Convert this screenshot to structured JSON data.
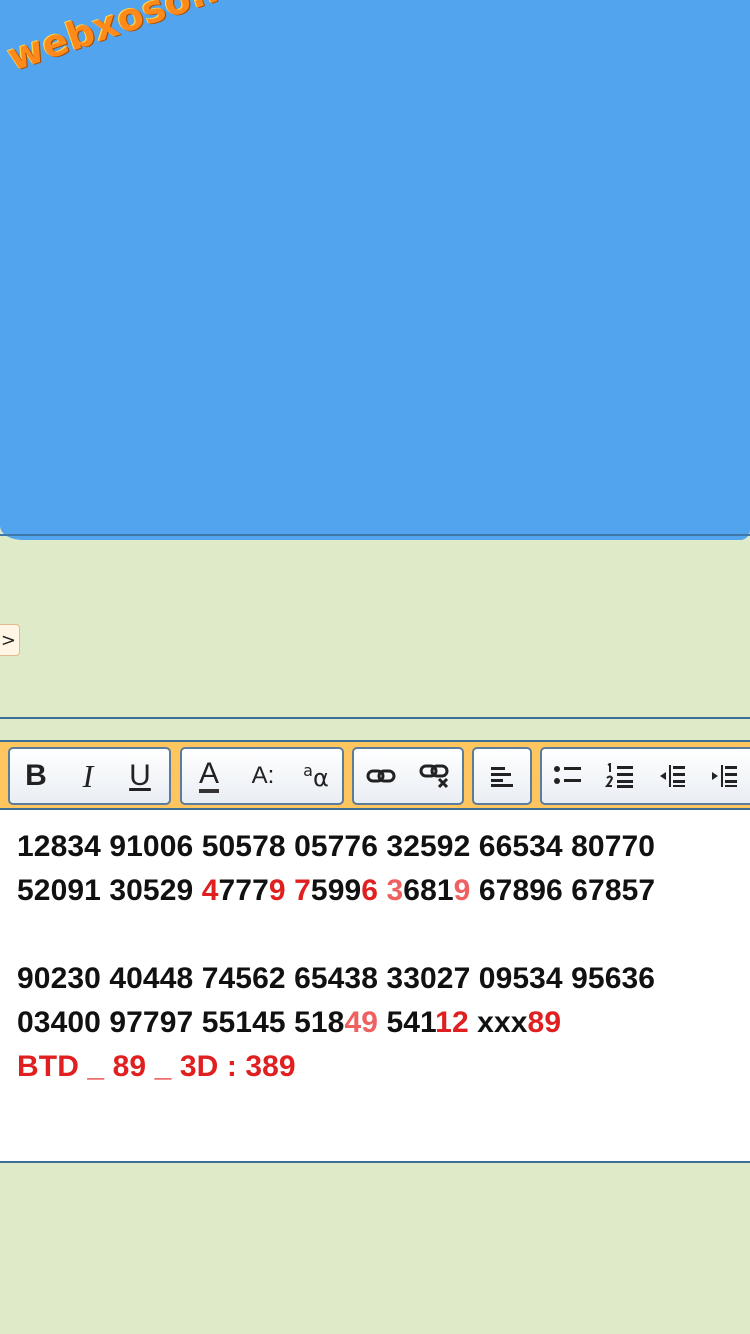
{
  "watermark": {
    "text": "webxoso.net"
  },
  "nav": {
    "arrow": ">"
  },
  "toolbar": {
    "groups": [
      {
        "name": "text-style",
        "buttons": [
          "bold-button",
          "italic-button",
          "underline-button"
        ]
      },
      {
        "name": "font",
        "buttons": [
          "font-color-button",
          "font-size-button",
          "font-family-button"
        ]
      },
      {
        "name": "links",
        "buttons": [
          "link-button",
          "unlink-button"
        ]
      },
      {
        "name": "align",
        "buttons": [
          "align-left-button"
        ]
      },
      {
        "name": "lists",
        "buttons": [
          "bulleted-list-button",
          "numbered-list-button",
          "outdent-button",
          "indent-button"
        ]
      }
    ],
    "labels": {
      "bold": "B",
      "italic": "I",
      "underline": "U",
      "font_color": "A",
      "font_size": "A:",
      "font_family_a": "a",
      "font_family_b": "α"
    }
  },
  "editor": {
    "lines": [
      {
        "segments": [
          {
            "text": "12834 91006 50578 05776 32592 66534 80770",
            "style": "plain"
          }
        ]
      },
      {
        "segments": [
          {
            "text": "52091 30529 ",
            "style": "plain"
          },
          {
            "text": "4",
            "style": "red"
          },
          {
            "text": "777",
            "style": "plain"
          },
          {
            "text": "9",
            "style": "red"
          },
          {
            "text": " ",
            "style": "plain"
          },
          {
            "text": "7",
            "style": "red"
          },
          {
            "text": "599",
            "style": "plain"
          },
          {
            "text": "6",
            "style": "red"
          },
          {
            "text": " ",
            "style": "plain"
          },
          {
            "text": "3",
            "style": "pink"
          },
          {
            "text": "681",
            "style": "plain"
          },
          {
            "text": "9",
            "style": "pink"
          },
          {
            "text": " 67896 67857",
            "style": "plain"
          }
        ]
      },
      {
        "segments": []
      },
      {
        "segments": [
          {
            "text": "90230 40448 74562 65438 33027 09534 95636",
            "style": "plain"
          }
        ]
      },
      {
        "segments": [
          {
            "text": "03400 97797 55145 518",
            "style": "plain"
          },
          {
            "text": "49",
            "style": "pink"
          },
          {
            "text": " 541",
            "style": "plain"
          },
          {
            "text": "12",
            "style": "red"
          },
          {
            "text": " xxx",
            "style": "plain"
          },
          {
            "text": "89",
            "style": "red"
          }
        ]
      },
      {
        "segments": [
          {
            "text": "BTD _ 89 _ 3D : 389",
            "style": "red"
          }
        ]
      }
    ]
  },
  "colors": {
    "scribble": "#52a4ef",
    "page_background": "#dfeac8",
    "toolbar_background": "#ffc55e",
    "highlight_red": "#e02020",
    "highlight_pink": "#ef6060",
    "logo_orange": "#ff8a1c"
  }
}
